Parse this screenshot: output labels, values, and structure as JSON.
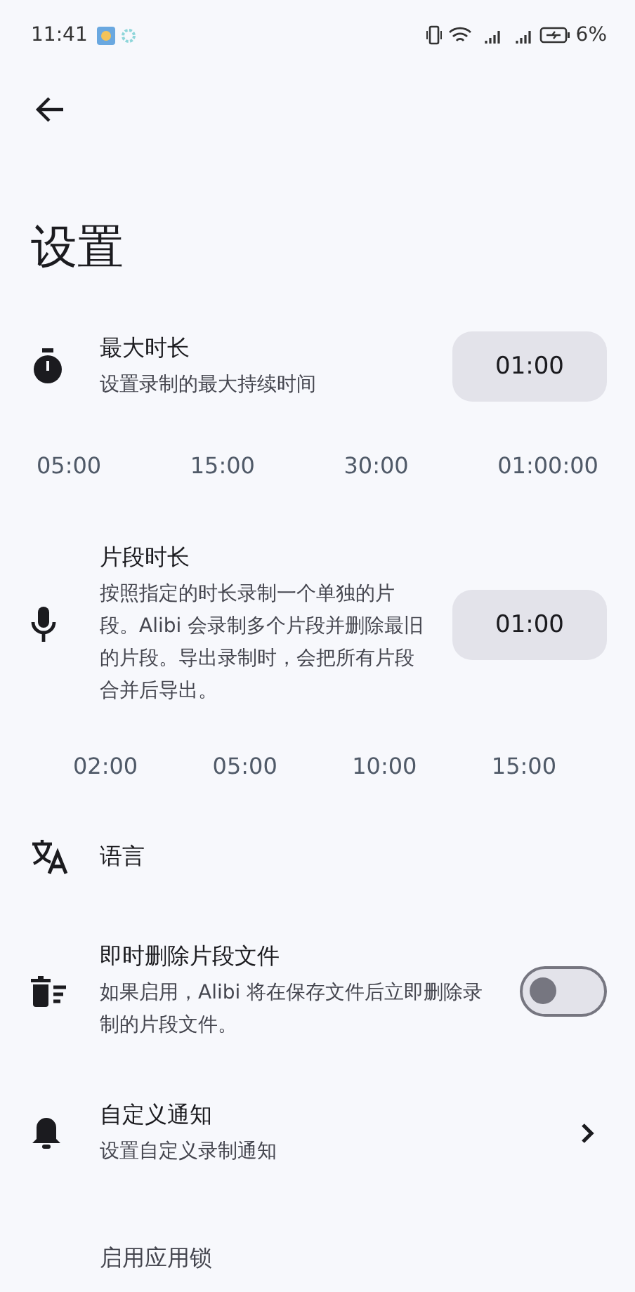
{
  "status_bar": {
    "time": "11:41",
    "battery": "6%"
  },
  "title": "设置",
  "settings": [
    {
      "kind": "duration",
      "title": "最大时长",
      "subtitle": "设置录制的最大持续时间",
      "value": "01:00",
      "presets": [
        "05:00",
        "15:00",
        "30:00",
        "01:00:00"
      ]
    },
    {
      "kind": "duration",
      "title": "片段时长",
      "subtitle": "按照指定的时长录制一个单独的片段。Alibi 会录制多个片段并删除最旧的片段。导出录制时，会把所有片段合并后导出。",
      "value": "01:00",
      "presets": [
        "02:00",
        "05:00",
        "10:00",
        "15:00"
      ]
    },
    {
      "kind": "link",
      "title": "语言"
    },
    {
      "kind": "toggle",
      "title": "即时删除片段文件",
      "subtitle": "如果启用，Alibi 将在保存文件后立即删除录制的片段文件。",
      "on": false
    },
    {
      "kind": "nav",
      "title": "自定义通知",
      "subtitle": "设置自定义录制通知"
    },
    {
      "kind": "partial",
      "subtitle": "启用应用锁"
    }
  ]
}
